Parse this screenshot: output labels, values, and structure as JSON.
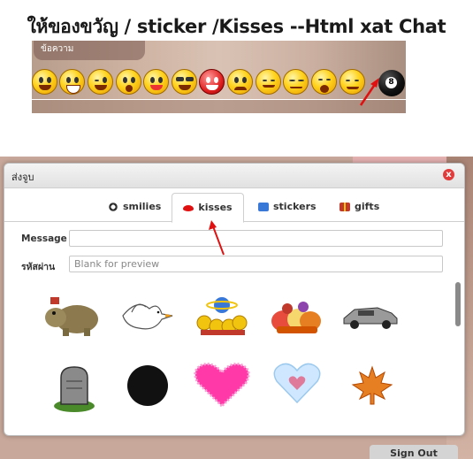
{
  "header_title": "ให้ของขวัญ / sticker /Kisses --Html xat Chat",
  "strip": {
    "bubble_text": "ข้อความ",
    "ball_label": "8",
    "emoji_count": 13
  },
  "dialog": {
    "title": "ส่งจูบ",
    "close_icon": "x",
    "tabs": [
      {
        "label": "smilies",
        "icon": "smiley-icon",
        "active": false
      },
      {
        "label": "kisses",
        "icon": "lips-icon",
        "active": true
      },
      {
        "label": "stickers",
        "icon": "sticker-icon",
        "active": false
      },
      {
        "label": "gifts",
        "icon": "gift-icon",
        "active": false
      }
    ],
    "message_label": "Message",
    "message_value": "",
    "password_label": "รหัสผ่าน",
    "password_placeholder": "Blank for preview",
    "items_row1": [
      "hippo-kiss-icon",
      "dove-icon",
      "planet-smilies-icon",
      "fruit-basket-icon",
      "delorean-car-icon"
    ],
    "items_row2": [
      "gravestone-icon",
      "black-circle-icon",
      "pink-heart-icon",
      "light-blue-heart-icon",
      "maple-leaf-icon"
    ]
  },
  "signout_label": "Sign Out",
  "colors": {
    "accent_red": "#e11010",
    "tab_blue": "#3a78d8"
  }
}
